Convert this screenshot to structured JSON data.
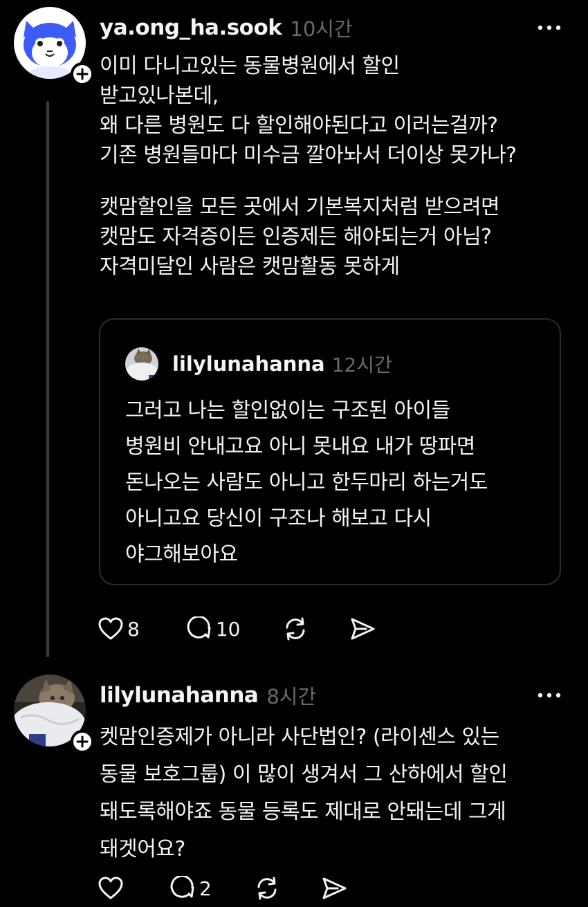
{
  "posts": [
    {
      "username": "ya.ong_ha.sook",
      "time": "10시간",
      "body_lines": [
        "이미 다니고있는 동물병원에서 할인",
        "받고있나본데,",
        "왜 다른 병원도 다 할인해야된다고 이러는걸까?",
        "기존 병원들마다 미수금 깔아놔서 더이상 못가나?",
        "",
        "캣맘할인을 모든 곳에서 기본복지처럼 받으려면",
        "캣맘도 자격증이든 인증제든 해야되는거 아님?",
        "자격미달인 사람은 캣맘활동 못하게"
      ],
      "quote": {
        "username": "lilylunahanna",
        "time": "12시간",
        "lines": [
          "그러고 나는 할인없이는  구조된 아이들",
          "병원비 안내고요 아니 못내요 내가 땅파면",
          "돈나오는 사람도 아니고 한두마리 하는거도",
          "아니고요 당신이 구조나 해보고 다시",
          "야그해보아요"
        ]
      },
      "likes": "8",
      "replies": "10",
      "icons": [
        "heart-icon",
        "comment-icon",
        "repost-icon",
        "share-icon"
      ]
    },
    {
      "username": "lilylunahanna",
      "time": "8시간",
      "body_lines": [
        "켓맘인증제가 아니라 사단법인? (라이센스 있는",
        "동물 보호그룹) 이 많이 생겨서 그 산하에서 할인",
        "돼도록해야죠 동물 등록도 제대로 안돼는데 그게",
        "돼겟어요?"
      ],
      "likes": "",
      "replies": "2",
      "icons": [
        "heart-icon",
        "comment-icon",
        "repost-icon",
        "share-icon"
      ]
    }
  ],
  "colors": {
    "background": "#000000",
    "text": "#f3f5f7",
    "muted": "#666a70",
    "thread_line": "#3a3a3a",
    "avatar_blue": "#3d5cf5"
  }
}
